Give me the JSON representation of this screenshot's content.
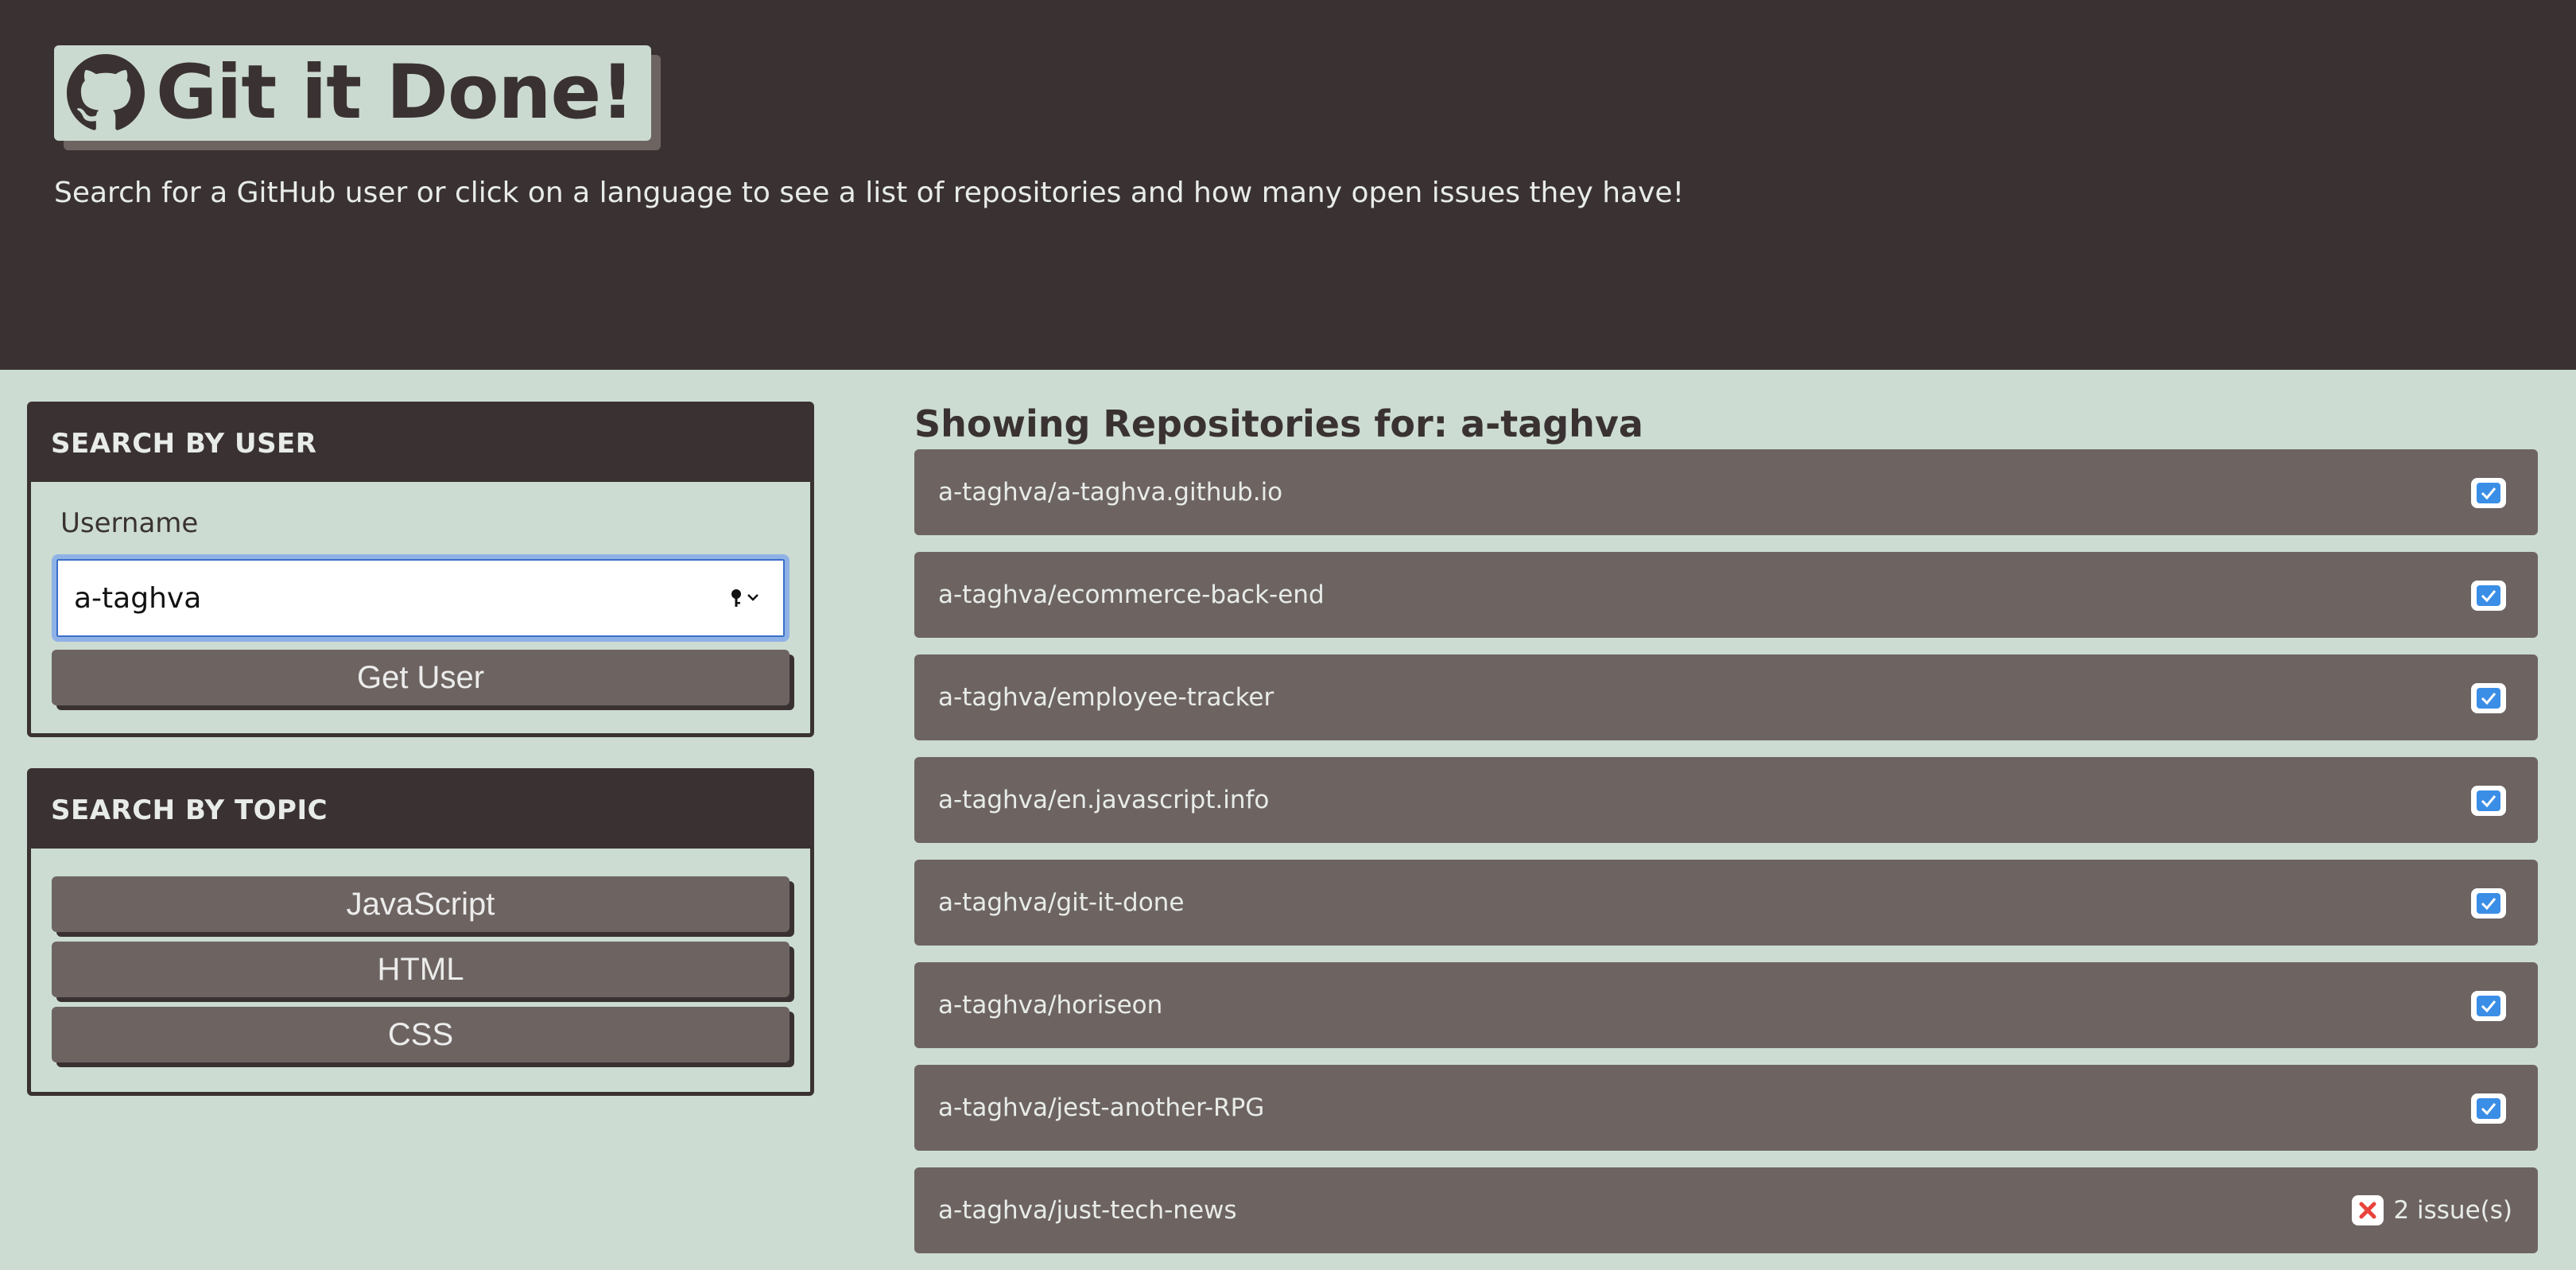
{
  "header": {
    "title": "Git it Done!",
    "logo_icon": "github-icon",
    "subtitle": "Search for a GitHub user or click on a language to see a list of repositories and how many open issues they have!"
  },
  "user_search": {
    "heading": "SEARCH BY USER",
    "label": "Username",
    "value": "a-taghva",
    "button": "Get User"
  },
  "topic_search": {
    "heading": "SEARCH BY TOPIC",
    "topics": [
      "JavaScript",
      "HTML",
      "CSS"
    ]
  },
  "repos": {
    "heading": "Showing Repositories for: a-taghva",
    "items": [
      {
        "name": "a-taghva/a-taghva.github.io",
        "status": "ok"
      },
      {
        "name": "a-taghva/ecommerce-back-end",
        "status": "ok"
      },
      {
        "name": "a-taghva/employee-tracker",
        "status": "ok"
      },
      {
        "name": "a-taghva/en.javascript.info",
        "status": "ok"
      },
      {
        "name": "a-taghva/git-it-done",
        "status": "ok"
      },
      {
        "name": "a-taghva/horiseon",
        "status": "ok"
      },
      {
        "name": "a-taghva/jest-another-RPG",
        "status": "ok"
      },
      {
        "name": "a-taghva/just-tech-news",
        "status": "issues",
        "issues": "2 issue(s)"
      }
    ]
  },
  "colors": {
    "background": "#ccdcd2",
    "dark": "#3a3232",
    "repo_row": "#6d6462",
    "check_blue": "#3b8ee6",
    "issue_red": "#e8433c"
  }
}
